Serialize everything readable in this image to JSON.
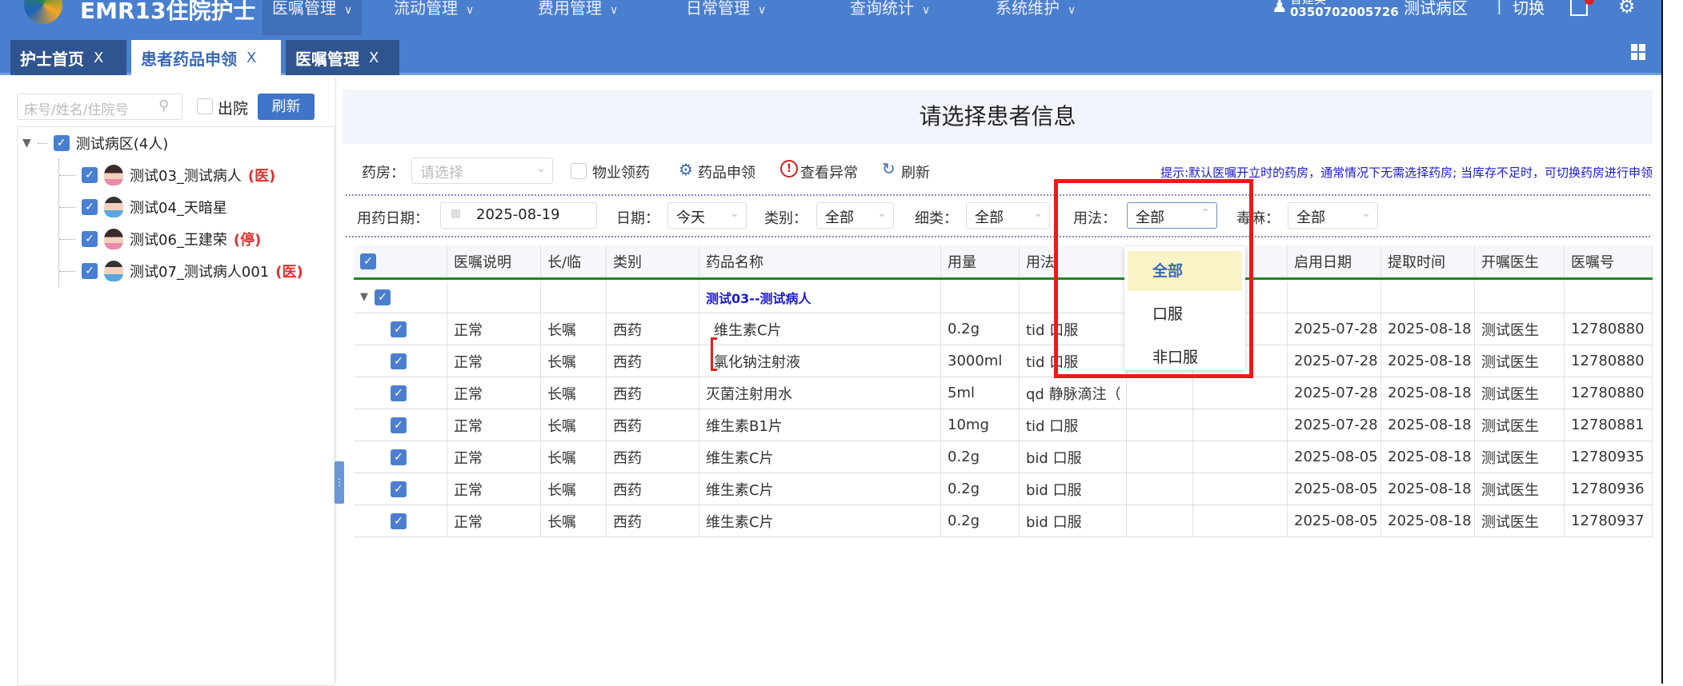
{
  "app": {
    "title": "EMR13住院护士",
    "menu": [
      {
        "label": "医嘱管理",
        "active": true
      },
      {
        "label": "流动管理"
      },
      {
        "label": "费用管理"
      },
      {
        "label": "日常管理"
      },
      {
        "label": "查询统计"
      },
      {
        "label": "系统维护"
      }
    ],
    "user": {
      "name": "曾建英",
      "id": "0350702005726",
      "ward": "测试病区",
      "separator": "|",
      "switch": "切换"
    },
    "brand_color": "#4a7fcf"
  },
  "tabs": [
    {
      "label": "护士首页",
      "close": "X"
    },
    {
      "label": "患者药品申领",
      "close": "X",
      "active": true
    },
    {
      "label": "医嘱管理",
      "close": "X"
    }
  ],
  "sidebar": {
    "search_placeholder": "床号/姓名/住院号",
    "discharge_label": "出院",
    "refresh": "刷新",
    "tree": {
      "root": "测试病区(4人)",
      "patients": [
        {
          "name": "测试03_测试病人",
          "tag": "(医)",
          "gender": "female"
        },
        {
          "name": "测试04_天暗星",
          "tag": "",
          "gender": "male"
        },
        {
          "name": "测试06_王建荣",
          "tag": "(停)",
          "gender": "female"
        },
        {
          "name": "测试07_测试病人001",
          "tag": "(医)",
          "gender": "male"
        }
      ]
    }
  },
  "main": {
    "title": "请选择患者信息",
    "toolbar": {
      "pharmacy_label": "药房：",
      "pharmacy_placeholder": "请选择",
      "property_label": "物业领药",
      "apply": "药品申领",
      "exception": "查看异常",
      "refresh": "刷新",
      "hint": "提示:默认医嘱开立时的药房，通常情况下无需选择药房; 当库存不足时，可切换药房进行申领"
    },
    "filters": {
      "date_label": "用药日期：",
      "date_value": "2025-08-19",
      "day_label": "日期：",
      "day_value": "今天",
      "category_label": "类别：",
      "category_value": "全部",
      "sub_label": "细类：",
      "sub_value": "全部",
      "usage_label": "用法：",
      "usage_value": "全部",
      "toxic_label": "毒麻：",
      "toxic_value": "全部"
    },
    "usage_dropdown": {
      "options": [
        "全部",
        "口服",
        "非口服"
      ],
      "selected": "全部"
    },
    "table": {
      "columns": [
        "",
        "医嘱说明",
        "长/临",
        "类别",
        "药品名称",
        "用量",
        "用法",
        "",
        "",
        "启用日期",
        "提取时间",
        "开嘱医生",
        "医嘱号"
      ],
      "group": "测试03--测试病人",
      "rows": [
        [
          "正常",
          "长嘱",
          "西药",
          "维生素C片",
          "0.2g",
          "tid 口服",
          "",
          "",
          "2025-07-28",
          "2025-08-18",
          "测试医生",
          "12780880"
        ],
        [
          "正常",
          "长嘱",
          "西药",
          "氯化钠注射液",
          "3000ml",
          "tid 口服",
          "",
          "",
          "2025-07-28",
          "2025-08-18",
          "测试医生",
          "12780880"
        ],
        [
          "正常",
          "长嘱",
          "西药",
          "灭菌注射用水",
          "5ml",
          "qd 静脉滴注（",
          "",
          "",
          "2025-07-28",
          "2025-08-18",
          "测试医生",
          "12780880"
        ],
        [
          "正常",
          "长嘱",
          "西药",
          "维生素B1片",
          "10mg",
          "tid 口服",
          "",
          "",
          "2025-07-28",
          "2025-08-18",
          "测试医生",
          "12780881"
        ],
        [
          "正常",
          "长嘱",
          "西药",
          "维生素C片",
          "0.2g",
          "bid 口服",
          "",
          "",
          "2025-08-05",
          "2025-08-18",
          "测试医生",
          "12780935"
        ],
        [
          "正常",
          "长嘱",
          "西药",
          "维生素C片",
          "0.2g",
          "bid 口服",
          "",
          "",
          "2025-08-05",
          "2025-08-18",
          "测试医生",
          "12780936"
        ],
        [
          "正常",
          "长嘱",
          "西药",
          "维生素C片",
          "0.2g",
          "bid 口服",
          "",
          "",
          "2025-08-05",
          "2025-08-18",
          "测试医生",
          "12780937"
        ]
      ]
    }
  },
  "highlight_color": "#f01818"
}
